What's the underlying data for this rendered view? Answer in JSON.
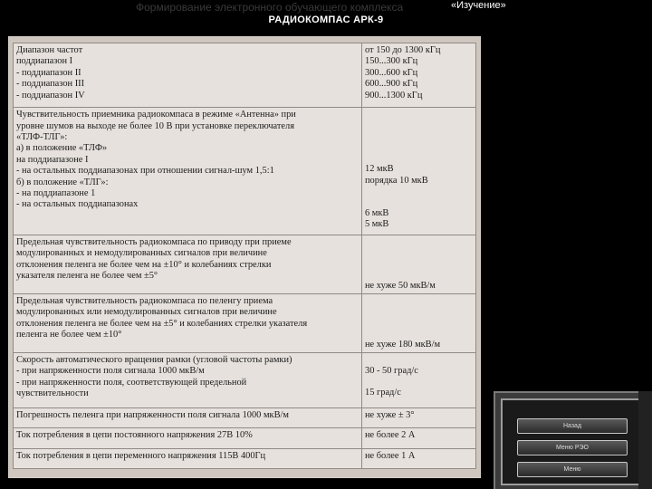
{
  "header": {
    "title": "Формирование электронного обучающего комплекса",
    "mode": "«Изучение»",
    "device": "РАДИОКОМПАС АРК-9"
  },
  "table": {
    "rows": [
      {
        "left": [
          "Диапазон частот",
          "   поддиапазон I",
          "- поддиапазон II",
          "- поддиапазон III",
          "- поддиапазон IV"
        ],
        "right": [
          "от 150 до 1300 кГц",
          "150...300 кГц",
          "300...600 кГц",
          "600...900 кГц",
          "900...1300 кГц"
        ]
      },
      {
        "left": [
          "Чувствительность приемника радиокомпаса в режиме «Антенна» при",
          "уровне шумов на выходе не более 10 В при установке переключателя",
          "«ТЛФ-ТЛГ»:",
          "а) в положение «ТЛФ»",
          "   на поддиапазоне I",
          "- на остальных поддиапазонах при отношении сигнал-шум 1,5:1",
          "б) в положение «ТЛГ»:",
          "- на поддиапазоне 1",
          "- на остальных поддиапазонах"
        ],
        "right": [
          "12 мкВ",
          "порядка 10 мкВ",
          "6 мкВ",
          "5 мкВ"
        ]
      },
      {
        "left": [
          "Предельная чувствительность радиокомпаса по приводу при приеме",
          "модулированных и немодулированных сигналов при величине",
          "отклонения пеленга не более чем на ±10° и колебаниях стрелки",
          "указателя пеленга не более чем ±5°"
        ],
        "right": [
          "не хуже 50 мкВ/м"
        ]
      },
      {
        "left": [
          "Предельная чувствительность радиокомпаса по пеленгу приема",
          "модулированных или немодулированных сигналов при величине",
          "отклонения пеленга не более чем на ±5° и колебаниях стрелки указателя",
          "пеленга не более чем ±10°"
        ],
        "right": [
          "не хуже 180 мкВ/м"
        ]
      },
      {
        "left": [
          "Скорость автоматического вращения рамки (угловой частоты рамки)",
          "- при напряженности поля сигнала 1000 мкВ/м",
          "- при напряженности поля, соответствующей предельной",
          "чувствительности"
        ],
        "right": [
          "30 - 50 град/с",
          "15 град/с"
        ]
      },
      {
        "left": [
          "Погрешность пеленга при напряженности поля сигнала 1000 мкВ/м"
        ],
        "right": [
          "не хуже ± 3°"
        ]
      },
      {
        "left": [
          "Ток потребления в цепи постоянного напряжения 27В 10%"
        ],
        "right": [
          "не более 2 А"
        ]
      },
      {
        "left": [
          "Ток потребления в цепи переменного напряжения 115В 400Гц"
        ],
        "right": [
          "не более 1 А"
        ]
      }
    ]
  },
  "side_menu": {
    "buttons": [
      "Назад",
      "Меню РЭО",
      "Меню"
    ]
  }
}
